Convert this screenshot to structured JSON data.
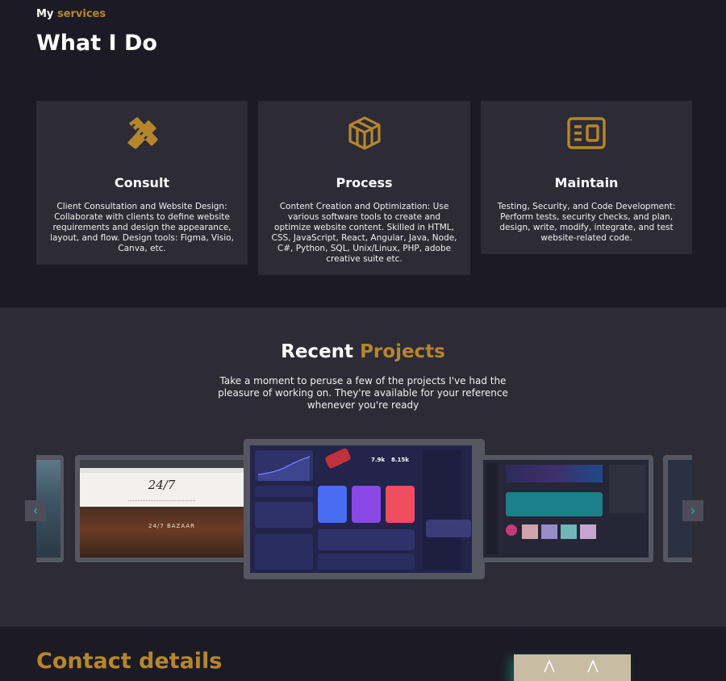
{
  "services": {
    "eyebrow_my": "My",
    "eyebrow_services": "services",
    "title": "What I Do",
    "cards": [
      {
        "icon": "pencil-ruler-icon",
        "title": "Consult",
        "desc": "Client Consultation and Website Design: Collaborate with clients to define website requirements and design the appearance, layout, and flow. Design tools: Figma, Visio, Canva, etc."
      },
      {
        "icon": "cube-icon",
        "title": "Process",
        "desc": "Content Creation and Optimization: Use various software tools to create and optimize website content. Skilled in HTML, CSS, JavaScript, React, Angular, Java, Node, C#, Python, SQL, Unix/Linux, PHP, adobe creative suite etc."
      },
      {
        "icon": "layout-icon",
        "title": "Maintain",
        "desc": "Testing, Security, and Code Development: Perform tests, security checks, and plan, design, write, modify, integrate, and test website-related code."
      }
    ]
  },
  "projects": {
    "title_main": "Recent",
    "title_accent": "Projects",
    "subtitle": "Take a moment to peruse a few of the projects I've had the pleasure of working on. They're available for your reference whenever you're ready",
    "slides": [
      {
        "name": "project-slide-1"
      },
      {
        "name": "project-slide-bazaar",
        "heading": "24/7",
        "banner": "24/7 BAZAAR"
      },
      {
        "name": "project-slide-dashboard",
        "stat1": "7.9k",
        "stat2": "8.15k"
      },
      {
        "name": "project-slide-music"
      },
      {
        "name": "project-slide-5"
      }
    ],
    "prev": "‹",
    "next": "›"
  },
  "contact": {
    "title": "Contact details"
  },
  "colors": {
    "accent": "#b6862c",
    "teal": "#1ec3a0",
    "bg_dark": "#1c1b25",
    "bg_card": "#2c2b36"
  }
}
